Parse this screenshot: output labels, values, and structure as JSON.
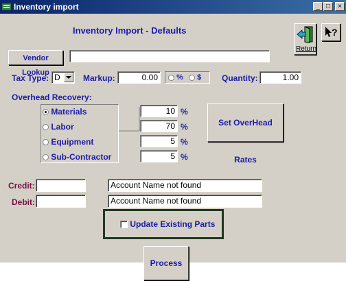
{
  "window": {
    "title": "Inventory import",
    "minimize": "_",
    "maximize": "□",
    "close": "×"
  },
  "header": {
    "title": "Inventory Import - Defaults"
  },
  "return_button": {
    "label": "Return"
  },
  "vendor": {
    "button_label": "Vendor Lookup",
    "value": ""
  },
  "tax": {
    "label": "Tax Type:",
    "value": "D"
  },
  "markup": {
    "label": "Markup:",
    "value": "0.00",
    "options": [
      "%",
      "$"
    ],
    "selected": "none"
  },
  "quantity": {
    "label": "Quantity:",
    "value": "1.00"
  },
  "overhead": {
    "label": "Overhead Recovery:",
    "items": [
      {
        "label": "Materials",
        "value": "10",
        "unit": "%",
        "selected": true
      },
      {
        "label": "Labor",
        "value": "70",
        "unit": "%",
        "selected": false
      },
      {
        "label": "Equipment",
        "value": "5",
        "unit": "%",
        "selected": false
      },
      {
        "label": "Sub-Contractor",
        "value": "5",
        "unit": "%",
        "selected": false
      }
    ],
    "set_rates_label": "Set OverHead Rates"
  },
  "accounts": {
    "credit_label": "Credit:",
    "credit_value": "",
    "credit_name": "Account Name not found",
    "debit_label": "Debit:",
    "debit_value": "",
    "debit_name": "Account Name not found"
  },
  "update_existing": {
    "label": "Update Existing Parts",
    "checked": false
  },
  "process_button": {
    "label": "Process"
  },
  "colors": {
    "label_blue": "#1c1ca8",
    "label_maroon": "#7a1040",
    "panel": "#d4d0c8",
    "title_bar": "#0a246a",
    "frame_green": "#203820"
  }
}
